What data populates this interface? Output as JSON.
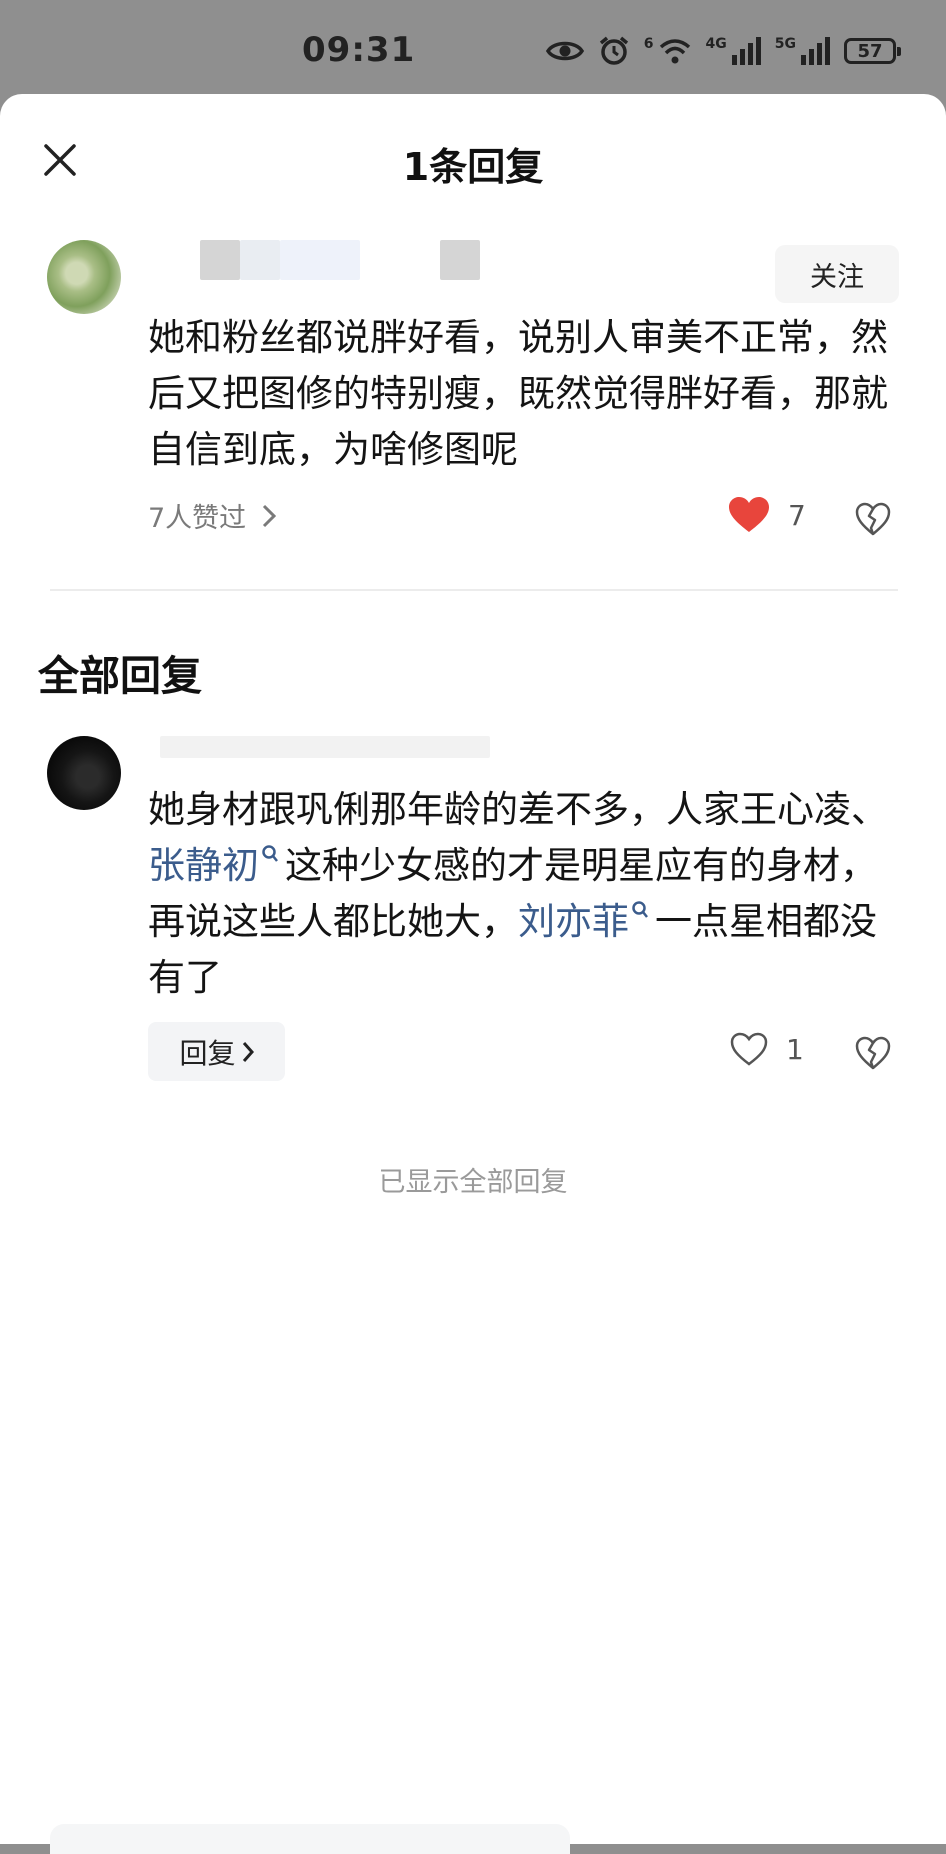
{
  "status_bar": {
    "time": "09:31",
    "network_1": "4G",
    "network_2": "5G",
    "wifi_label": "6",
    "battery": "57"
  },
  "header": {
    "title": "1条回复",
    "close_icon": "close-icon"
  },
  "main_comment": {
    "follow_label": "关注",
    "text": "她和粉丝都说胖好看，说别人审美不正常，然后又把图修的特别瘦，既然觉得胖好看，那就自信到底，为啥修图呢",
    "likers_label": "7人赞过",
    "like_count": "7",
    "like_state": "liked",
    "like_color": "#e8453c"
  },
  "section": {
    "title": "全部回复"
  },
  "reply": {
    "text_part1": "她身材跟巩俐那年龄的差不多，人家王心凌、",
    "link1": "张静初",
    "text_part2": "这种少女感的才是明星应有的身材，再说这些人都比她大，",
    "link2": "刘亦菲",
    "text_part3": "一点星相都没有了",
    "link_color": "#3b5c8c",
    "reply_button_label": "回复",
    "like_count": "1"
  },
  "footer": {
    "all_shown": "已显示全部回复"
  }
}
